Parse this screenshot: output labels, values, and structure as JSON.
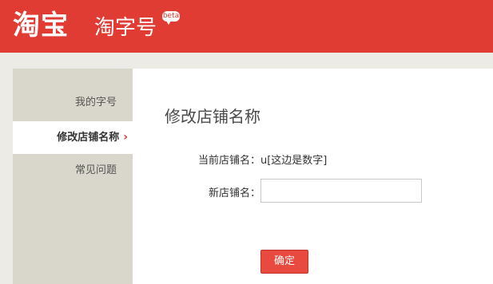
{
  "header": {
    "logo_text": "淘宝",
    "product_name": "淘字号",
    "badge": "beta"
  },
  "sidebar": {
    "items": [
      {
        "label": "我的字号"
      },
      {
        "label": "修改店铺名称",
        "active": true
      },
      {
        "label": "常见问题"
      }
    ]
  },
  "main": {
    "title": "修改店铺名称",
    "current_name_label": "当前店铺名：",
    "current_name_value": "u[这边是数字]",
    "new_name_label": "新店铺名：",
    "new_name_value": "",
    "confirm_label": "确定"
  },
  "colors": {
    "brand_red": "#e03c33",
    "button_red": "#e84a3f",
    "sidebar_bg": "#d9d6cb",
    "page_bg": "#ecebe6"
  },
  "icons": {
    "active_indicator": "chevron-right-icon"
  }
}
